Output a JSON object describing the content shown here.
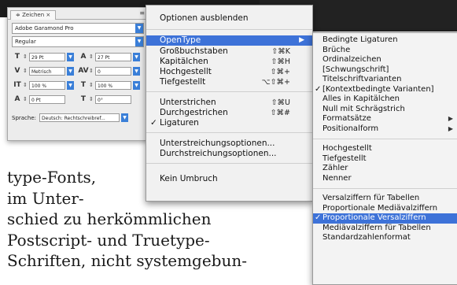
{
  "panel": {
    "tab_label": "≑ Zeichen ×",
    "menu_glyph": "≡",
    "font_family": "Adobe Garamond Pro",
    "font_style": "Regular",
    "size": "29 Pt",
    "leading": "27 Pt",
    "kerning": "Metrisch",
    "tracking": "0",
    "vscale": "100 %",
    "hscale": "100 %",
    "baseline": "0 Pt",
    "skew": "0°",
    "language_label": "Sprache:",
    "language": "Deutsch: Rechtschreibref..."
  },
  "menu": {
    "hide_options": "Optionen ausblenden",
    "opentype": "OpenType",
    "caps": "Großbuchstaben",
    "caps_sc": "⇧⌘K",
    "smallcaps": "Kapitälchen",
    "smallcaps_sc": "⇧⌘H",
    "superscript": "Hochgestellt",
    "superscript_sc": "⇧⌘+",
    "subscript": "Tiefgestellt",
    "subscript_sc": "⌥⇧⌘+",
    "underline": "Unterstrichen",
    "underline_sc": "⇧⌘U",
    "strikethrough": "Durchgestrichen",
    "strikethrough_sc": "⇧⌘#",
    "ligatures": "Ligaturen",
    "underline_options": "Unterstreichungsoptionen...",
    "strike_options": "Durchstreichungsoptionen...",
    "no_break": "Kein Umbruch"
  },
  "submenu": {
    "items_a": [
      "Bedingte Ligaturen",
      "Brüche",
      "Ordinalzeichen",
      "[Schwungschrift]",
      "Titelschriftvarianten"
    ],
    "contextual": "[Kontextbedingte Varianten]",
    "items_b": [
      "Alles in Kapitälchen",
      "Null mit Schrägstrich"
    ],
    "formatsaetze": "Formatsätze",
    "positionalform": "Positionalform",
    "items_c": [
      "Hochgestellt",
      "Tiefgestellt",
      "Zähler",
      "Nenner"
    ],
    "items_d": [
      "Versalziffern für Tabellen",
      "Proportionale Mediävalziffern"
    ],
    "proportional_versal": "Proportionale Versalziffern",
    "items_e": [
      "Mediävalziffern für Tabellen",
      "Standardzahlenformat"
    ]
  },
  "body_text": [
    "type-Fonts,",
    "im Unter-",
    "schied zu herkömmlichen",
    "Postscript- und Truetype-",
    "Schriften, nicht systemgebun-"
  ],
  "icons": {
    "check": "✓",
    "submenu_arrow": "▶"
  }
}
